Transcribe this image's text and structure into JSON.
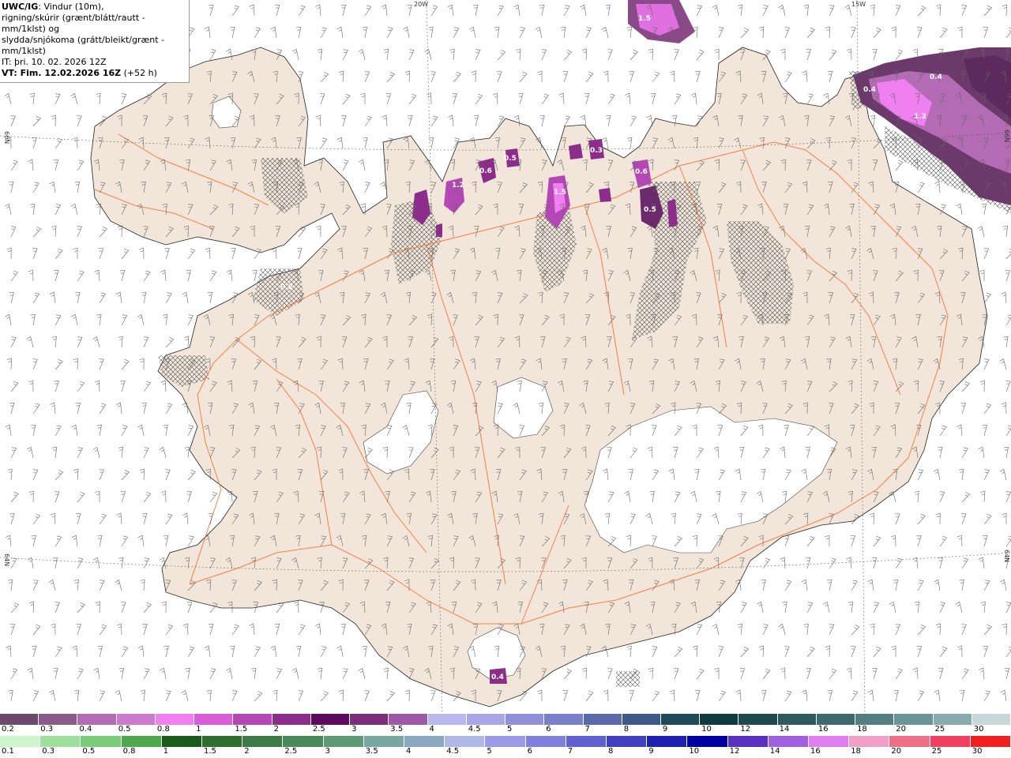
{
  "header": {
    "line1_bold": "UWC/IG",
    "line1_rest": ": Vindur (10m),",
    "line2": "rigning/skúrir (grænt/blátt/rautt - mm/1klst) og",
    "line3": "slydda/snjókoma (grátt/bleikt/grænt - mm/1klst)",
    "line4": "IT: þri. 10. 02. 2026 12Z",
    "line5_bold": "VT: Fim. 12.02.2026 16Z",
    "line5_rest": " (+52 h)"
  },
  "grid_labels": {
    "lon_20w": "20W",
    "lon_15w": "15W",
    "lat_66n_left": "66N",
    "lat_66n_right": "66N",
    "lat_64n_left": "64N",
    "lat_64n_right": "64N"
  },
  "precip_labels": [
    {
      "id": "nw-cell",
      "text": "1.5"
    },
    {
      "id": "ne-cell-a",
      "text": "0.4"
    },
    {
      "id": "ne-cell-b",
      "text": "0.4"
    },
    {
      "id": "ne-cell-c",
      "text": "1.2"
    },
    {
      "id": "north-a",
      "text": "1.5"
    },
    {
      "id": "north-b",
      "text": "0.5"
    },
    {
      "id": "north-c",
      "text": "0.6"
    },
    {
      "id": "north-d",
      "text": "1.2"
    },
    {
      "id": "north-e",
      "text": "0.3"
    },
    {
      "id": "north-f",
      "text": "0.6"
    },
    {
      "id": "north-g",
      "text": "0.5"
    },
    {
      "id": "west-a",
      "text": "0.2"
    },
    {
      "id": "south-a",
      "text": "0.4"
    }
  ],
  "legend_snow": {
    "labels": [
      "0.2",
      "0.3",
      "0.4",
      "0.5",
      "0.8",
      "1",
      "1.5",
      "2",
      "2.5",
      "3",
      "3.5",
      "4",
      "4.5",
      "5",
      "6",
      "7",
      "8",
      "9",
      "10",
      "12",
      "14",
      "16",
      "18",
      "20",
      "25",
      "30"
    ],
    "colors": [
      "#6b4a6b",
      "#8a5a8a",
      "#b36bb3",
      "#cc7acc",
      "#f080f0",
      "#d95fd9",
      "#b347b3",
      "#8c2d8c",
      "#5c0a5c",
      "#7a2e7a",
      "#9e5aa6",
      "#b9b9f0",
      "#a8a8e6",
      "#9090d8",
      "#7a80c8",
      "#5a6aa8",
      "#3d5a86",
      "#1f4a5a",
      "#0e3a40",
      "#1e4a4e",
      "#2e5a5e",
      "#3e6a6e",
      "#547e82",
      "#6a9498",
      "#8aabae",
      "#c8d8d8"
    ]
  },
  "legend_rain": {
    "labels": [
      "0.1",
      "0.3",
      "0.5",
      "0.8",
      "1",
      "1.5",
      "2",
      "2.5",
      "3",
      "3.5",
      "4",
      "4.5",
      "5",
      "6",
      "7",
      "8",
      "9",
      "10",
      "12",
      "14",
      "16",
      "18",
      "20",
      "25",
      "30"
    ],
    "colors": [
      "#ccf5cc",
      "#9fe09f",
      "#7acc7a",
      "#4fa84f",
      "#1a5a1a",
      "#2e6e2e",
      "#3c7a46",
      "#4a8a5a",
      "#5e9a74",
      "#78a8a0",
      "#8aa8c0",
      "#b0b8e8",
      "#9a9ae6",
      "#8080dc",
      "#6060d0",
      "#4040c0",
      "#2020b0",
      "#0000a0",
      "#5a30c0",
      "#a060e0",
      "#e080f0",
      "#f0a0c8",
      "#f07088",
      "#f04060",
      "#f02020"
    ]
  }
}
